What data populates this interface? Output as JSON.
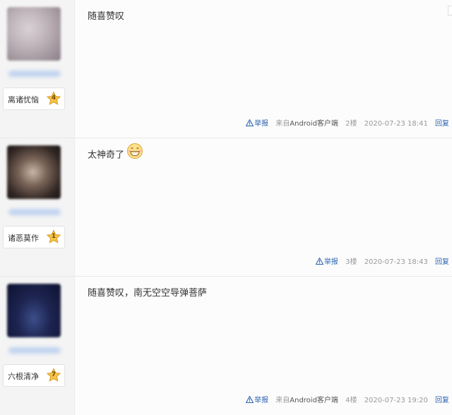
{
  "posts": [
    {
      "username": "离诸忧恼",
      "level": "4",
      "content": "随喜赞叹",
      "report": "举报",
      "source_prefix": "来自",
      "source_app": "Android客户端",
      "floor": "2楼",
      "datetime": "2020-07-23 18:41",
      "reply": "回复"
    },
    {
      "username": "诸恶莫作",
      "level": "1",
      "content": "太神奇了",
      "emoji": "grinning-face-icon",
      "report": "举报",
      "floor": "3楼",
      "datetime": "2020-07-23 18:43",
      "reply": "回复"
    },
    {
      "username": "六根清净",
      "level": "7",
      "content": "随喜赞叹，南无空空导弹菩萨",
      "report": "举报",
      "source_prefix": "来自",
      "source_app": "Android客户端",
      "floor": "4楼",
      "datetime": "2020-07-23 19:20",
      "reply": "回复"
    }
  ],
  "colors": {
    "link": "#2d64b3",
    "meta": "#999999",
    "level_badge": "#f3c449"
  }
}
